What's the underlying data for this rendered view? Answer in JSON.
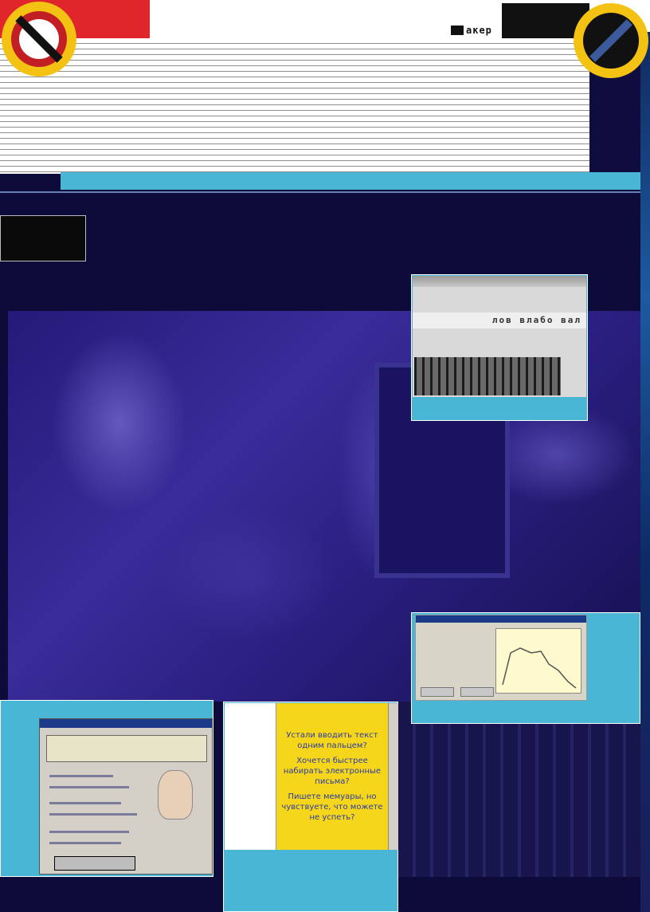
{
  "header": {
    "logo_text": "акер"
  },
  "screenshot_top": {
    "typing_line": "лов влабо вал"
  },
  "ad_panel": {
    "line1": "Устали вводить текст",
    "line2": "одним пальцем?",
    "line3": "Хочется быстрее",
    "line4": "набирать электронные",
    "line5": "письма?",
    "line6": "Пишете мемуары, но",
    "line7": "чувствуете, что можете",
    "line8": "не успеть?"
  },
  "colors": {
    "accent_cyan": "#49b6d6",
    "accent_red": "#e0262b",
    "gear_yellow": "#f3c212",
    "background_navy": "#0d0b3a",
    "hero_purple": "#3a2c9a"
  },
  "icons": {
    "left": "no-entry-gear-icon",
    "right": "gear-badge-icon"
  }
}
